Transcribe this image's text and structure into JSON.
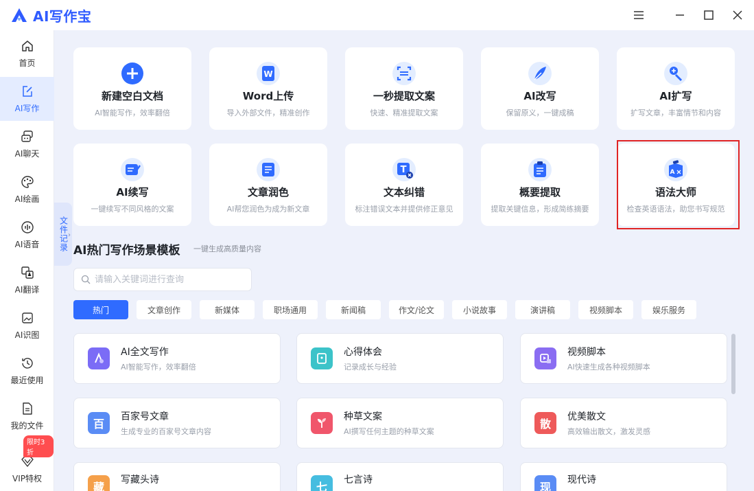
{
  "app": {
    "title": "AI写作宝"
  },
  "sidebar": {
    "items": [
      {
        "label": "首页",
        "icon": "home-icon"
      },
      {
        "label": "AI写作",
        "icon": "edit-icon",
        "active": true
      },
      {
        "label": "AI聊天",
        "icon": "chat-icon"
      },
      {
        "label": "AI绘画",
        "icon": "palette-icon"
      },
      {
        "label": "AI语音",
        "icon": "voice-icon"
      },
      {
        "label": "AI翻译",
        "icon": "translate-icon"
      },
      {
        "label": "AI识图",
        "icon": "image-icon"
      },
      {
        "label": "最近使用",
        "icon": "history-icon"
      },
      {
        "label": "我的文件",
        "icon": "file-icon"
      },
      {
        "label": "VIP特权",
        "icon": "vip-icon"
      }
    ],
    "vip_badge": "限时3折"
  },
  "file_tab": {
    "label": "文件记录"
  },
  "tools": [
    {
      "title": "新建空白文档",
      "desc": "AI智能写作，效率翻倍"
    },
    {
      "title": "Word上传",
      "desc": "导入外部文件，精准创作"
    },
    {
      "title": "一秒提取文案",
      "desc": "快速、精准提取文案"
    },
    {
      "title": "AI改写",
      "desc": "保留原义，一键成稿"
    },
    {
      "title": "AI扩写",
      "desc": "扩写文章，丰富情节和内容"
    },
    {
      "title": "AI续写",
      "desc": "一键续写不同风格的文案"
    },
    {
      "title": "文章润色",
      "desc": "AI帮您润色为成为新文章"
    },
    {
      "title": "文本纠错",
      "desc": "标注错误文本并提供修正意见"
    },
    {
      "title": "概要提取",
      "desc": "提取关键信息，形成简练摘要"
    },
    {
      "title": "语法大师",
      "desc": "检查英语语法，助您书写规范"
    }
  ],
  "section": {
    "title": "AI热门写作场景模板",
    "subtitle": "一键生成高质量内容"
  },
  "search": {
    "placeholder": "请输入关键词进行查询",
    "value": ""
  },
  "tags": [
    "热门",
    "文章创作",
    "新媒体",
    "职场通用",
    "新闻稿",
    "作文/论文",
    "小说故事",
    "演讲稿",
    "视频脚本",
    "娱乐服务"
  ],
  "templates": [
    {
      "title": "AI全文写作",
      "desc": "AI智能写作，效率翻倍",
      "color": "#7b6cf6"
    },
    {
      "title": "心得体会",
      "desc": "记录成长与经验",
      "color": "#3cc3c9"
    },
    {
      "title": "视频脚本",
      "desc": "AI快速生成各种视频脚本",
      "color": "#8a6df2"
    },
    {
      "title": "百家号文章",
      "desc": "生成专业的百家号文章内容",
      "glyph": "百",
      "color": "#5a8cf5"
    },
    {
      "title": "种草文案",
      "desc": "AI撰写任何主题的种草文案",
      "color": "#f0566b"
    },
    {
      "title": "优美散文",
      "desc": "高效输出散文，激发灵感",
      "glyph": "散",
      "color": "#ee5a5a"
    },
    {
      "title": "写藏头诗",
      "desc": "",
      "glyph": "藏",
      "color": "#f5a04a"
    },
    {
      "title": "七言诗",
      "desc": "",
      "glyph": "七",
      "color": "#46bde0"
    },
    {
      "title": "现代诗",
      "desc": "",
      "glyph": "现",
      "color": "#5a8cf5"
    }
  ]
}
